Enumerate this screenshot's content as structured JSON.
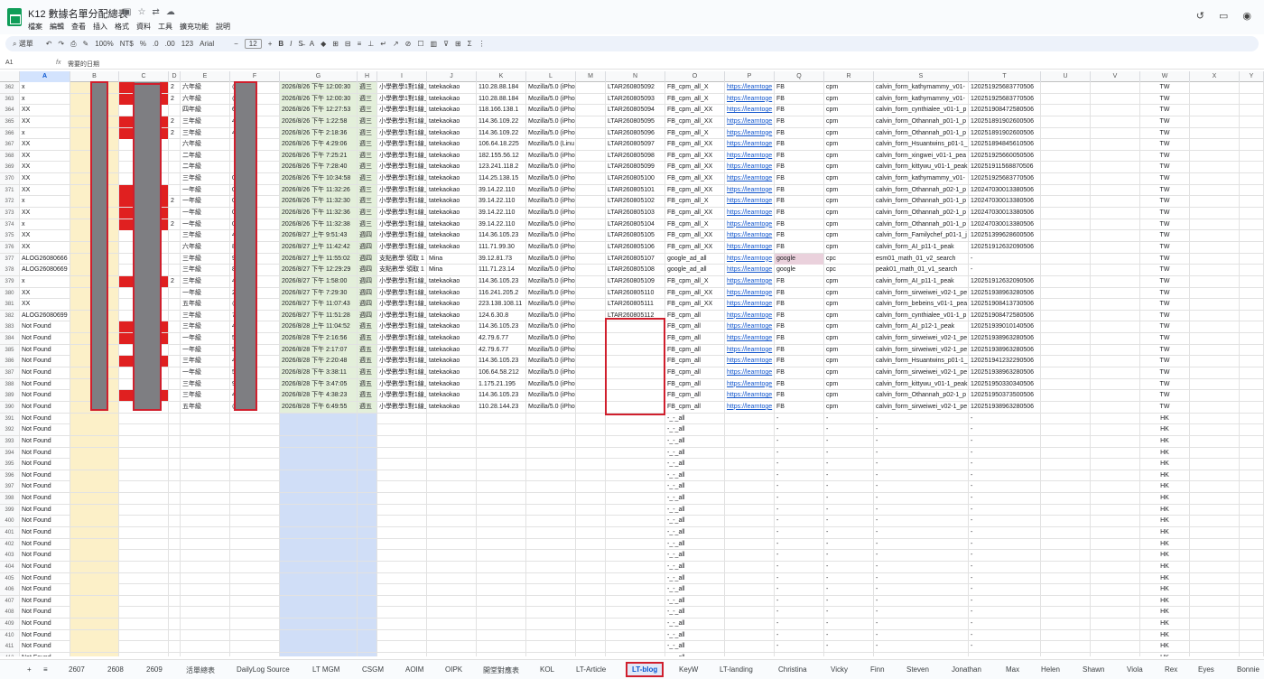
{
  "window": {
    "title": "K12 數據名單分配總表",
    "menu": [
      "檔案",
      "編輯",
      "查看",
      "插入",
      "格式",
      "資料",
      "工具",
      "擴充功能",
      "說明"
    ]
  },
  "toolbar": {
    "search_label": "選單",
    "zoom": "100%",
    "currency": "NT$",
    "percent": "%",
    "dec_less": ".0",
    "dec_more": ".00",
    "num_format": "123",
    "font": "Arial",
    "font_size": "12",
    "bold": "B",
    "italic": "I"
  },
  "formula_bar": {
    "cell_ref": "A1",
    "fx": "fx",
    "value": "需要的日期"
  },
  "columns": [
    "A",
    "B",
    "C",
    "D",
    "E",
    "F",
    "G",
    "H",
    "I",
    "J",
    "K",
    "L",
    "M",
    "N",
    "O",
    "P",
    "Q",
    "R",
    "S",
    "T",
    "U",
    "V",
    "W",
    "X",
    "Y"
  ],
  "selected_column": "A",
  "rows": [
    {
      "n": "362",
      "a": "x",
      "d": "2",
      "e": "六年級",
      "f": "@gmail",
      "g": "2026/8/26 下午 12:00:30",
      "h": "週三",
      "i": "小學數學1對1線上",
      "j": "tatekaokao",
      "k": "110.28.88.184",
      "l": "Mozilla/5.0 (iPho",
      "n2": "LTAR260805092",
      "o": "FB_cpm_all_X",
      "p": "https://learntoge",
      "q": "FB",
      "r": "cpm",
      "s": "calvin_form_kathymammy_v01-",
      "t": "120251925683770506",
      "w": "TW"
    },
    {
      "n": "363",
      "a": "x",
      "d": "2",
      "e": "六年級",
      "f": "@gmail",
      "g": "2026/8/26 下午 12:00:30",
      "h": "週三",
      "i": "小學數學1對1線上",
      "j": "tatekaokao",
      "k": "110.28.88.184",
      "l": "Mozilla/5.0 (iPho",
      "n2": "LTAR260805093",
      "o": "FB_cpm_all_X",
      "p": "https://learntoge",
      "q": "FB",
      "r": "cpm",
      "s": "calvin_form_kathymammy_v01-",
      "t": "120251925683770506",
      "w": "TW"
    },
    {
      "n": "364",
      "a": "XX",
      "d": "",
      "e": "四年級",
      "f": "6@hotr",
      "g": "2026/8/26 下午 12:27:53",
      "h": "週三",
      "i": "小學數學1對1線上",
      "j": "tatekaokao",
      "k": "118.166.138.1",
      "l": "Mozilla/5.0 (iPho",
      "n2": "LTAR260805094",
      "o": "FB_cpm_all_XX",
      "p": "https://learntoge",
      "q": "FB",
      "r": "cpm",
      "s": "calvin_form_cynthialee_v01-1_p",
      "t": "120251908472580506",
      "w": "TW"
    },
    {
      "n": "365",
      "a": "XX",
      "d": "2",
      "e": "三年級",
      "f": "4258@",
      "g": "2026/8/26 下午 1:22:58",
      "h": "週三",
      "i": "小學數學1對1線上",
      "j": "tatekaokao",
      "k": "114.36.109.22",
      "l": "Mozilla/5.0 (iPho",
      "n2": "LTAR260805095",
      "o": "FB_cpm_all_XX",
      "p": "https://learntoge",
      "q": "FB",
      "r": "cpm",
      "s": "calvin_form_Othannah_p01-1_p",
      "t": "120251891902600506",
      "w": "TW"
    },
    {
      "n": "366",
      "a": "x",
      "d": "2",
      "e": "三年級",
      "f": "4258@",
      "g": "2026/8/26 下午 2:18:36",
      "h": "週三",
      "i": "小學數學1對1線上",
      "j": "tatekaokao",
      "k": "114.36.109.22",
      "l": "Mozilla/5.0 (iPho",
      "n2": "LTAR260805096",
      "o": "FB_cpm_all_X",
      "p": "https://learntoge",
      "q": "FB",
      "r": "cpm",
      "s": "calvin_form_Othannah_p01-1_p",
      "t": "120251891902600506",
      "w": "TW"
    },
    {
      "n": "367",
      "a": "XX",
      "d": "",
      "e": "六年級",
      "f": "",
      "g": "2026/8/26 下午 4:29:06",
      "h": "週三",
      "i": "小學數學1對1線上",
      "j": "tatekaokao",
      "k": "106.64.18.225",
      "l": "Mozilla/5.0 (Linu",
      "n2": "LTAR260805097",
      "o": "FB_cpm_all_XX",
      "p": "https://learntoge",
      "q": "FB",
      "r": "cpm",
      "s": "calvin_form_Hsuantwins_p01-1_",
      "t": "120251894845610506",
      "w": "TW"
    },
    {
      "n": "368",
      "a": "XX",
      "d": "",
      "e": "二年級",
      "f": "",
      "g": "2026/8/26 下午 7:25:21",
      "h": "週三",
      "i": "小學數學1對1線上",
      "j": "tatekaokao",
      "k": "182.155.56.12",
      "l": "Mozilla/5.0 (iPho",
      "n2": "LTAR260805098",
      "o": "FB_cpm_all_XX",
      "p": "https://learntoge",
      "q": "FB",
      "r": "cpm",
      "s": "calvin_form_xingwei_v01-1_pea",
      "t": "120251925660050506",
      "w": "TW"
    },
    {
      "n": "369",
      "a": "XX",
      "d": "",
      "e": "二年級",
      "f": "",
      "g": "2026/8/26 下午 7:28:40",
      "h": "週三",
      "i": "小學數學1對1線上",
      "j": "tatekaokao",
      "k": "123.241.118.2",
      "l": "Mozilla/5.0 (iPho",
      "n2": "LTAR260805099",
      "o": "FB_cpm_all_XX",
      "p": "https://learntoge",
      "q": "FB",
      "r": "cpm",
      "s": "calvin_form_kittywu_v01-1_peak",
      "t": "120251911568870506",
      "w": "TW"
    },
    {
      "n": "370",
      "a": "XX",
      "d": "",
      "e": "三年級",
      "f": "00@gm",
      "g": "2026/8/26 下午 10:34:58",
      "h": "週三",
      "i": "小學數學1對1線上",
      "j": "tatekaokao",
      "k": "114.25.138.15",
      "l": "Mozilla/5.0 (iPho",
      "n2": "LTAR260805100",
      "o": "FB_cpm_all_XX",
      "p": "https://learntoge",
      "q": "FB",
      "r": "cpm",
      "s": "calvin_form_kathymammy_v01-",
      "t": "120251925683770506",
      "w": "TW"
    },
    {
      "n": "371",
      "a": "XX",
      "d": "",
      "e": "一年級",
      "f": "005061",
      "g": "2026/8/26 下午 11:32:26",
      "h": "週三",
      "i": "小學數學1對1線上",
      "j": "tatekaokao",
      "k": "39.14.22.110",
      "l": "Mozilla/5.0 (iPho",
      "n2": "LTAR260805101",
      "o": "FB_cpm_all_XX",
      "p": "https://learntoge",
      "q": "FB",
      "r": "cpm",
      "s": "calvin_form_Othannah_p02-1_p",
      "t": "120247030013380506",
      "w": "TW"
    },
    {
      "n": "372",
      "a": "x",
      "d": "2",
      "e": "一年級",
      "f": "005061",
      "g": "2026/8/26 下午 11:32:30",
      "h": "週三",
      "i": "小學數學1對1線上",
      "j": "tatekaokao",
      "k": "39.14.22.110",
      "l": "Mozilla/5.0 (iPho",
      "n2": "LTAR260805102",
      "o": "FB_cpm_all_X",
      "p": "https://learntoge",
      "q": "FB",
      "r": "cpm",
      "s": "calvin_form_Othannah_p01-1_p",
      "t": "120247030013380506",
      "w": "TW"
    },
    {
      "n": "373",
      "a": "XX",
      "d": "",
      "e": "一年級",
      "f": "005061",
      "g": "2026/8/26 下午 11:32:36",
      "h": "週三",
      "i": "小學數學1對1線上",
      "j": "tatekaokao",
      "k": "39.14.22.110",
      "l": "Mozilla/5.0 (iPho",
      "n2": "LTAR260805103",
      "o": "FB_cpm_all_XX",
      "p": "https://learntoge",
      "q": "FB",
      "r": "cpm",
      "s": "calvin_form_Othannah_p02-1_p",
      "t": "120247030013380506",
      "w": "TW"
    },
    {
      "n": "374",
      "a": "x",
      "d": "2",
      "e": "一年級",
      "f": "005061",
      "g": "2026/8/26 下午 11:32:38",
      "h": "週三",
      "i": "小學數學1對1線上",
      "j": "tatekaokao",
      "k": "39.14.22.110",
      "l": "Mozilla/5.0 (iPho",
      "n2": "LTAR260805104",
      "o": "FB_cpm_all_X",
      "p": "https://learntoge",
      "q": "FB",
      "r": "cpm",
      "s": "calvin_form_Othannah_p01-1_p",
      "t": "120247030013380506",
      "w": "TW"
    },
    {
      "n": "375",
      "a": "XX",
      "d": "",
      "e": "三年級",
      "f": "4258@",
      "g": "2026/8/27 上午 9:51:43",
      "h": "週四",
      "i": "小學數學1對1線上",
      "j": "tatekaokao",
      "k": "114.36.105.23",
      "l": "Mozilla/5.0 (iPho",
      "n2": "LTAR260805105",
      "o": "FB_cpm_all_XX",
      "p": "https://learntoge",
      "q": "FB",
      "r": "cpm",
      "s": "calvin_form_Familychef_p01-1_j",
      "t": "120251399628600506",
      "w": "TW"
    },
    {
      "n": "376",
      "a": "XX",
      "d": "",
      "e": "六年級",
      "f": "8@gma",
      "g": "2026/8/27 上午 11:42:42",
      "h": "週四",
      "i": "小學數學1對1線上",
      "j": "tatekaokao",
      "k": "111.71.99.30",
      "l": "Mozilla/5.0 (iPho",
      "n2": "LTAR260805106",
      "o": "FB_cpm_all_XX",
      "p": "https://learntoge",
      "q": "FB",
      "r": "cpm",
      "s": "calvin_form_AI_p11-1_peak",
      "t": "120251912632090506",
      "w": "TW"
    },
    {
      "n": "377",
      "a": "ALOG26080666",
      "d": "",
      "e": "三年級",
      "f": "928@gr",
      "g": "2026/8/27 上午 11:55:02",
      "h": "週四",
      "i": "支點數學 領取 1",
      "j": "Mina",
      "k": "39.12.81.73",
      "l": "Mozilla/5.0 (iPho",
      "n2": "LTAR260805107",
      "o": "google_ad_all",
      "p": "https://learntoge",
      "q": "google",
      "r": "cpc",
      "s": "esm01_math_01_v2_search",
      "t": "-",
      "w": "TW",
      "qp": true
    },
    {
      "n": "378",
      "a": "ALOG26080669",
      "d": "",
      "e": "三年級",
      "f": "8@gma",
      "g": "2026/8/27 下午 12:29:29",
      "h": "週四",
      "i": "支點數學 領取 1",
      "j": "Mina",
      "k": "111.71.23.14",
      "l": "Mozilla/5.0 (iPho",
      "n2": "LTAR260805108",
      "o": "google_ad_all",
      "p": "https://learntoge",
      "q": "google",
      "r": "cpc",
      "s": "peak01_math_01_v1_search",
      "t": "-",
      "w": "TW"
    },
    {
      "n": "379",
      "a": "x",
      "d": "2",
      "e": "三年級",
      "f": "4258@",
      "g": "2026/8/27 下午 1:58:00",
      "h": "週四",
      "i": "小學數學1對1線上",
      "j": "tatekaokao",
      "k": "114.36.105.23",
      "l": "Mozilla/5.0 (iPho",
      "n2": "LTAR260805109",
      "o": "FB_cpm_all_X",
      "p": "https://learntoge",
      "q": "FB",
      "r": "cpm",
      "s": "calvin_form_AI_p11-1_peak",
      "t": "120251912632090506",
      "w": "TW"
    },
    {
      "n": "380",
      "a": "XX",
      "d": "",
      "e": "一年級",
      "f": "26@gm",
      "g": "2026/8/27 下午 7:29:30",
      "h": "週四",
      "i": "小學數學1對1線上",
      "j": "tatekaokao",
      "k": "116.241.205.2",
      "l": "Mozilla/5.0 (iPho",
      "n2": "LTAR260805110",
      "o": "FB_cpm_all_XX",
      "p": "https://learntoge",
      "q": "FB",
      "r": "cpm",
      "s": "calvin_form_sirweiwei_v02-1_pe",
      "t": "120251938963280506",
      "w": "TW"
    },
    {
      "n": "381",
      "a": "XX",
      "d": "",
      "e": "五年級",
      "f": "@gmail",
      "g": "2026/8/27 下午 11:07:43",
      "h": "週四",
      "i": "小學數學1對1線上",
      "j": "tatekaokao",
      "k": "223.138.108.11",
      "l": "Mozilla/5.0 (iPho",
      "n2": "LTAR260805111",
      "o": "FB_cpm_all_XX",
      "p": "https://learntoge",
      "q": "FB",
      "r": "cpm",
      "s": "calvin_form_bebeins_v01-1_pea",
      "t": "120251908413730506",
      "w": "TW"
    },
    {
      "n": "382",
      "a": "ALOG26080699",
      "d": "",
      "e": "三年級",
      "f": "74430@",
      "g": "2026/8/27 下午 11:51:28",
      "h": "週四",
      "i": "小學數學1對1線上",
      "j": "tatekaokao",
      "k": "124.6.30.8",
      "l": "Mozilla/5.0 (iPho",
      "n2": "LTAR260805112",
      "o": "FB_cpm_all",
      "p": "https://learntoge",
      "q": "FB",
      "r": "cpm",
      "s": "calvin_form_cynthialee_v01-1_p",
      "t": "120251908472580506",
      "w": "TW"
    },
    {
      "n": "383",
      "a": "Not Found",
      "d": "",
      "e": "三年級",
      "f": "4258@",
      "g": "2026/8/28 上午 11:04:52",
      "h": "週五",
      "i": "小學數學1對1線上",
      "j": "tatekaokao",
      "k": "114.36.105.23",
      "l": "Mozilla/5.0 (iPho",
      "n2": "",
      "o": "FB_cpm_all",
      "p": "https://learntoge",
      "q": "FB",
      "r": "cpm",
      "s": "calvin_form_AI_p12-1_peak",
      "t": "120251939010140506",
      "w": "TW"
    },
    {
      "n": "384",
      "a": "Not Found",
      "d": "",
      "e": "一年級",
      "f": "5@yahc",
      "g": "2026/8/28 下午 2:16:56",
      "h": "週五",
      "i": "小學數學1對1線上",
      "j": "tatekaokao",
      "k": "42.79.6.77",
      "l": "Mozilla/5.0 (iPho",
      "n2": "",
      "o": "FB_cpm_all",
      "p": "https://learntoge",
      "q": "FB",
      "r": "cpm",
      "s": "calvin_form_sirweiwei_v02-1_pe",
      "t": "120251938963280506",
      "w": "TW"
    },
    {
      "n": "385",
      "a": "Not Found",
      "d": "",
      "e": "一年級",
      "f": "5@yahc",
      "g": "2026/8/28 下午 2:17:07",
      "h": "週五",
      "i": "小學數學1對1線上",
      "j": "tatekaokao",
      "k": "42.79.6.77",
      "l": "Mozilla/5.0 (iPho",
      "n2": "",
      "o": "FB_cpm_all",
      "p": "https://learntoge",
      "q": "FB",
      "r": "cpm",
      "s": "calvin_form_sirweiwei_v02-1_pe",
      "t": "120251938963280506",
      "w": "TW"
    },
    {
      "n": "386",
      "a": "Not Found",
      "d": "",
      "e": "三年級",
      "f": "4258@",
      "g": "2026/8/28 下午 2:20:48",
      "h": "週五",
      "i": "小學數學1對1線上",
      "j": "tatekaokao",
      "k": "114.36.105.23",
      "l": "Mozilla/5.0 (iPho",
      "n2": "",
      "o": "FB_cpm_all",
      "p": "https://learntoge",
      "q": "FB",
      "r": "cpm",
      "s": "calvin_form_Hsuantwins_p01-1_",
      "t": "120251941232290506",
      "w": "TW"
    },
    {
      "n": "387",
      "a": "Not Found",
      "d": "",
      "e": "一年級",
      "f": "5821@",
      "g": "2026/8/28 下午 3:38:11",
      "h": "週五",
      "i": "小學數學1對1線上",
      "j": "tatekaokao",
      "k": "106.64.58.212",
      "l": "Mozilla/5.0 (iPho",
      "n2": "",
      "o": "FB_cpm_all",
      "p": "https://learntoge",
      "q": "FB",
      "r": "cpm",
      "s": "calvin_form_sirweiwei_v02-1_pe",
      "t": "120251938963280506",
      "w": "TW"
    },
    {
      "n": "388",
      "a": "Not Found",
      "d": "",
      "e": "三年級",
      "f": "925@yz",
      "g": "2026/8/28 下午 3:47:05",
      "h": "週五",
      "i": "小學數學1對1線上",
      "j": "tatekaokao",
      "k": "1.175.21.195",
      "l": "Mozilla/5.0 (iPho",
      "n2": "",
      "o": "FB_cpm_all",
      "p": "https://learntoge",
      "q": "FB",
      "r": "cpm",
      "s": "calvin_form_kittywu_v01-1_peak",
      "t": "120251950330340506",
      "w": "TW"
    },
    {
      "n": "389",
      "a": "Not Found",
      "d": "",
      "e": "三年級",
      "f": "4258@",
      "g": "2026/8/28 下午 4:38:23",
      "h": "週五",
      "i": "小學數學1對1線上",
      "j": "tatekaokao",
      "k": "114.36.105.23",
      "l": "Mozilla/5.0 (iPho",
      "n2": "",
      "o": "FB_cpm_all",
      "p": "https://learntoge",
      "q": "FB",
      "r": "cpm",
      "s": "calvin_form_Othannah_p02-1_p",
      "t": "120251950373500506",
      "w": "TW"
    },
    {
      "n": "390",
      "a": "Not Found",
      "d": "",
      "e": "五年級",
      "f": "@gmail",
      "g": "2026/8/28 下午 6:49:55",
      "h": "週五",
      "i": "小學數學1對1線上",
      "j": "tatekaokao",
      "k": "110.28.144.23",
      "l": "Mozilla/5.0 (iPho",
      "n2": "",
      "o": "FB_cpm_all",
      "p": "https://learntoge",
      "q": "FB",
      "r": "cpm",
      "s": "calvin_form_sirweiwei_v02-1_pe",
      "t": "120251938963280506",
      "w": "TW"
    }
  ],
  "empty_rows": {
    "start": 391,
    "end": 414,
    "a": "Not Found",
    "o": "-_-_all",
    "q": "-",
    "r": "-",
    "s": "-",
    "t": "-",
    "w": "HK"
  },
  "tabs": [
    "+",
    "≡",
    "2607",
    "2608",
    "2609",
    "活單總表",
    "DailyLog Source",
    "LT MGM",
    "CSGM",
    "AOIM",
    "OIPK",
    "開堂對應表",
    "KOL",
    "LT-Article",
    "LT-blog",
    "KeyW",
    "LT-landing",
    "Christina",
    "Vicky",
    "Finn",
    "Steven",
    "Jonathan",
    "Max",
    "Helen",
    "Shawn",
    "Viola",
    "Rex",
    "Eyes",
    "Bonnie"
  ],
  "active_tab": "LT-blog",
  "colors": {
    "highlight_red": "#d01f2d",
    "link": "#1155cc",
    "active_tab": "#0b57d0"
  }
}
